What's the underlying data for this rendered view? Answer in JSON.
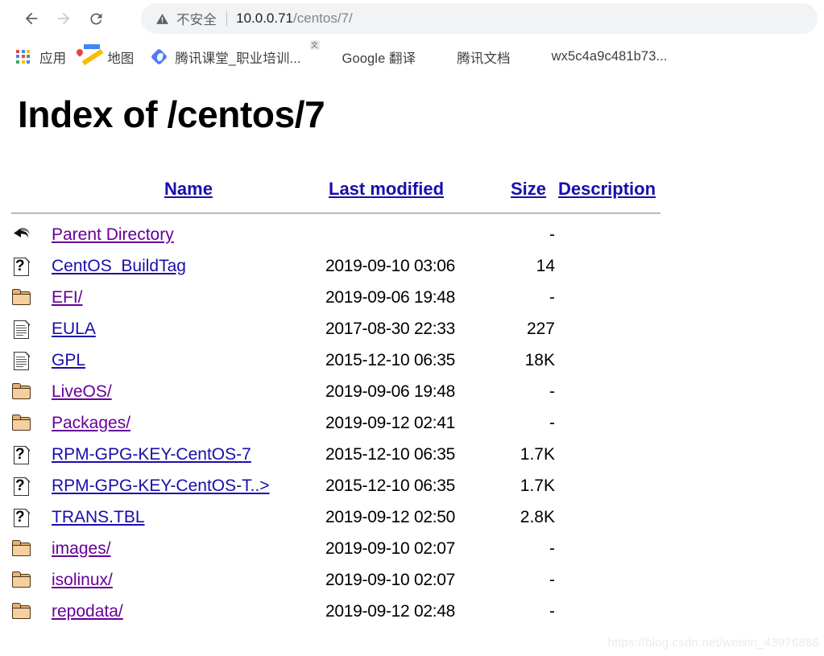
{
  "browser": {
    "back_label": "Back",
    "forward_label": "Forward",
    "reload_label": "Reload",
    "security_label": "不安全",
    "url_host": "10.0.0.71",
    "url_path": "/centos/7/",
    "bookmarks": [
      {
        "label": "应用",
        "icon": "apps-grid-icon"
      },
      {
        "label": "地图",
        "icon": "google-maps-icon"
      },
      {
        "label": "腾讯课堂_职业培训...",
        "icon": "tencent-classroom-icon"
      },
      {
        "label": "Google 翻译",
        "icon": "google-translate-icon"
      },
      {
        "label": "腾讯文档",
        "icon": "tencent-docs-icon"
      },
      {
        "label": "wx5c4a9c481b73...",
        "icon": "wechat-note-icon"
      }
    ]
  },
  "page": {
    "title": "Index of /centos/7",
    "columns": {
      "name": "Name",
      "last_modified": "Last modified",
      "size": "Size",
      "description": "Description"
    },
    "rows": [
      {
        "icon": "back-arrow-icon",
        "name": "Parent Directory",
        "visited": true,
        "date": "",
        "size": "-",
        "desc": ""
      },
      {
        "icon": "unknown-file-icon",
        "name": "CentOS_BuildTag",
        "visited": false,
        "date": "2019-09-10 03:06",
        "size": "14",
        "desc": ""
      },
      {
        "icon": "folder-icon",
        "name": "EFI/",
        "visited": true,
        "date": "2019-09-06 19:48",
        "size": "-",
        "desc": ""
      },
      {
        "icon": "text-file-icon",
        "name": "EULA",
        "visited": false,
        "date": "2017-08-30 22:33",
        "size": "227",
        "desc": ""
      },
      {
        "icon": "text-file-icon",
        "name": "GPL",
        "visited": false,
        "date": "2015-12-10 06:35",
        "size": "18K",
        "desc": ""
      },
      {
        "icon": "folder-icon",
        "name": "LiveOS/",
        "visited": true,
        "date": "2019-09-06 19:48",
        "size": "-",
        "desc": ""
      },
      {
        "icon": "folder-icon",
        "name": "Packages/",
        "visited": true,
        "date": "2019-09-12 02:41",
        "size": "-",
        "desc": ""
      },
      {
        "icon": "unknown-file-icon",
        "name": "RPM-GPG-KEY-CentOS-7",
        "visited": false,
        "date": "2015-12-10 06:35",
        "size": "1.7K",
        "desc": ""
      },
      {
        "icon": "unknown-file-icon",
        "name": "RPM-GPG-KEY-CentOS-T..>",
        "visited": false,
        "date": "2015-12-10 06:35",
        "size": "1.7K",
        "desc": ""
      },
      {
        "icon": "unknown-file-icon",
        "name": "TRANS.TBL",
        "visited": false,
        "date": "2019-09-12 02:50",
        "size": "2.8K",
        "desc": ""
      },
      {
        "icon": "folder-icon",
        "name": "images/",
        "visited": true,
        "date": "2019-09-10 02:07",
        "size": "-",
        "desc": ""
      },
      {
        "icon": "folder-icon",
        "name": "isolinux/",
        "visited": true,
        "date": "2019-09-10 02:07",
        "size": "-",
        "desc": ""
      },
      {
        "icon": "folder-icon",
        "name": "repodata/",
        "visited": true,
        "date": "2019-09-12 02:48",
        "size": "-",
        "desc": ""
      }
    ]
  },
  "watermark": "https://blog.csdn.net/weixin_43976886",
  "colors": {
    "link": "#1a0dab",
    "visited_link": "#660099",
    "folder": "#f5cf9e",
    "url_bar": "#f1f3f4"
  }
}
